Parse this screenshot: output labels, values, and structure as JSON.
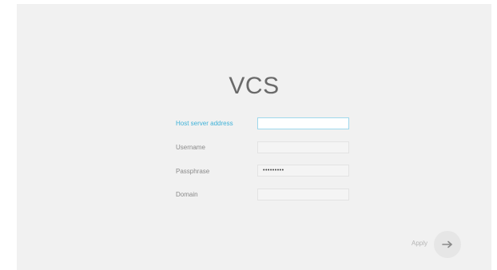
{
  "app": {
    "title": "VCS"
  },
  "form": {
    "fields": [
      {
        "label": "Host server address",
        "value": "",
        "active": true
      },
      {
        "label": "Username",
        "value": ""
      },
      {
        "label": "Passphrase",
        "value": "•••••••••"
      },
      {
        "label": "Domain",
        "value": ""
      }
    ]
  },
  "actions": {
    "apply_label": "Apply",
    "apply_icon": "arrow-right-icon"
  },
  "colors": {
    "accent": "#3fb2d8",
    "panel": "#f1f1f1"
  }
}
